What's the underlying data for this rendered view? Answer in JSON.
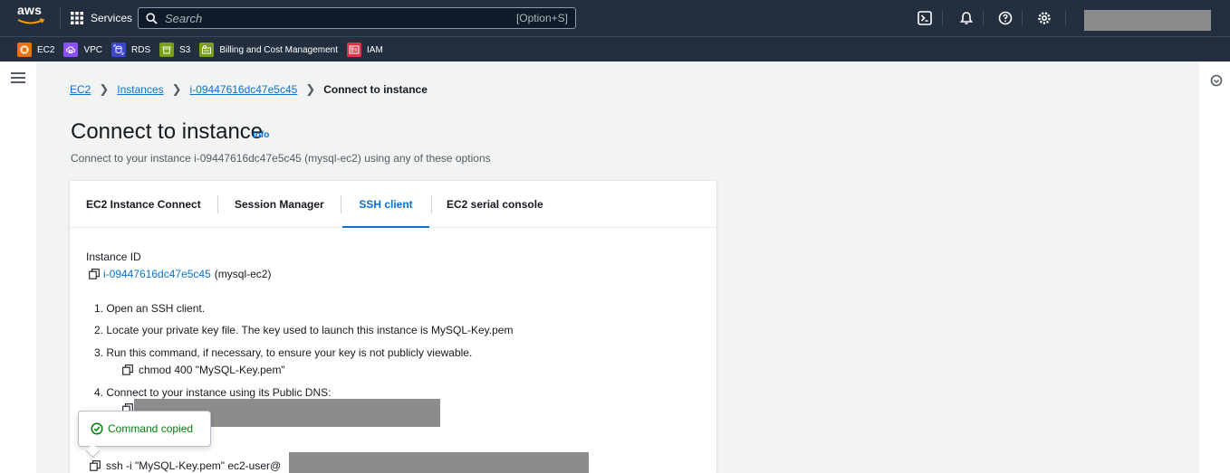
{
  "topbar": {
    "logo_text": "aws",
    "services_label": "Services",
    "search_placeholder": "Search",
    "search_shortcut": "[Option+S]",
    "icons": [
      "cloudshell-icon",
      "bell-icon",
      "help-icon",
      "settings-icon"
    ]
  },
  "favorites": [
    {
      "label": "EC2",
      "color": "#ed7100"
    },
    {
      "label": "VPC",
      "color": "#8c4fff"
    },
    {
      "label": "RDS",
      "color": "#3b48cc"
    },
    {
      "label": "S3",
      "color": "#7aa116"
    },
    {
      "label": "Billing and Cost Management",
      "color": "#7aa116"
    },
    {
      "label": "IAM",
      "color": "#dd344c"
    }
  ],
  "breadcrumb": {
    "items": [
      "EC2",
      "Instances",
      "i-09447616dc47e5c45"
    ],
    "current": "Connect to instance"
  },
  "header": {
    "title": "Connect to instance",
    "info": "Info",
    "subtitle": "Connect to your instance i-09447616dc47e5c45 (mysql-ec2) using any of these options"
  },
  "tabs": [
    {
      "label": "EC2 Instance Connect",
      "active": false
    },
    {
      "label": "Session Manager",
      "active": false
    },
    {
      "label": "SSH client",
      "active": true
    },
    {
      "label": "EC2 serial console",
      "active": false
    }
  ],
  "ssh": {
    "instance_label": "Instance ID",
    "instance_id": "i-09447616dc47e5c45",
    "instance_name": "(mysql-ec2)",
    "steps": [
      "1. Open an SSH client.",
      "2. Locate your private key file. The key used to launch this instance is MySQL-Key.pem",
      "3. Run this command, if necessary, to ensure your key is not publicly viewable.",
      "4. Connect to your instance using its Public DNS:"
    ],
    "chmod_command": "chmod 400 \"MySQL-Key.pem\"",
    "ssh_command": "ssh -i \"MySQL-Key.pem\" ec2-user@"
  },
  "popover": {
    "text": "Command copied"
  },
  "colors": {
    "nav_bg": "#232f3e",
    "link": "#0972d3",
    "success": "#037f0c",
    "page_bg": "#f2f3f3"
  }
}
